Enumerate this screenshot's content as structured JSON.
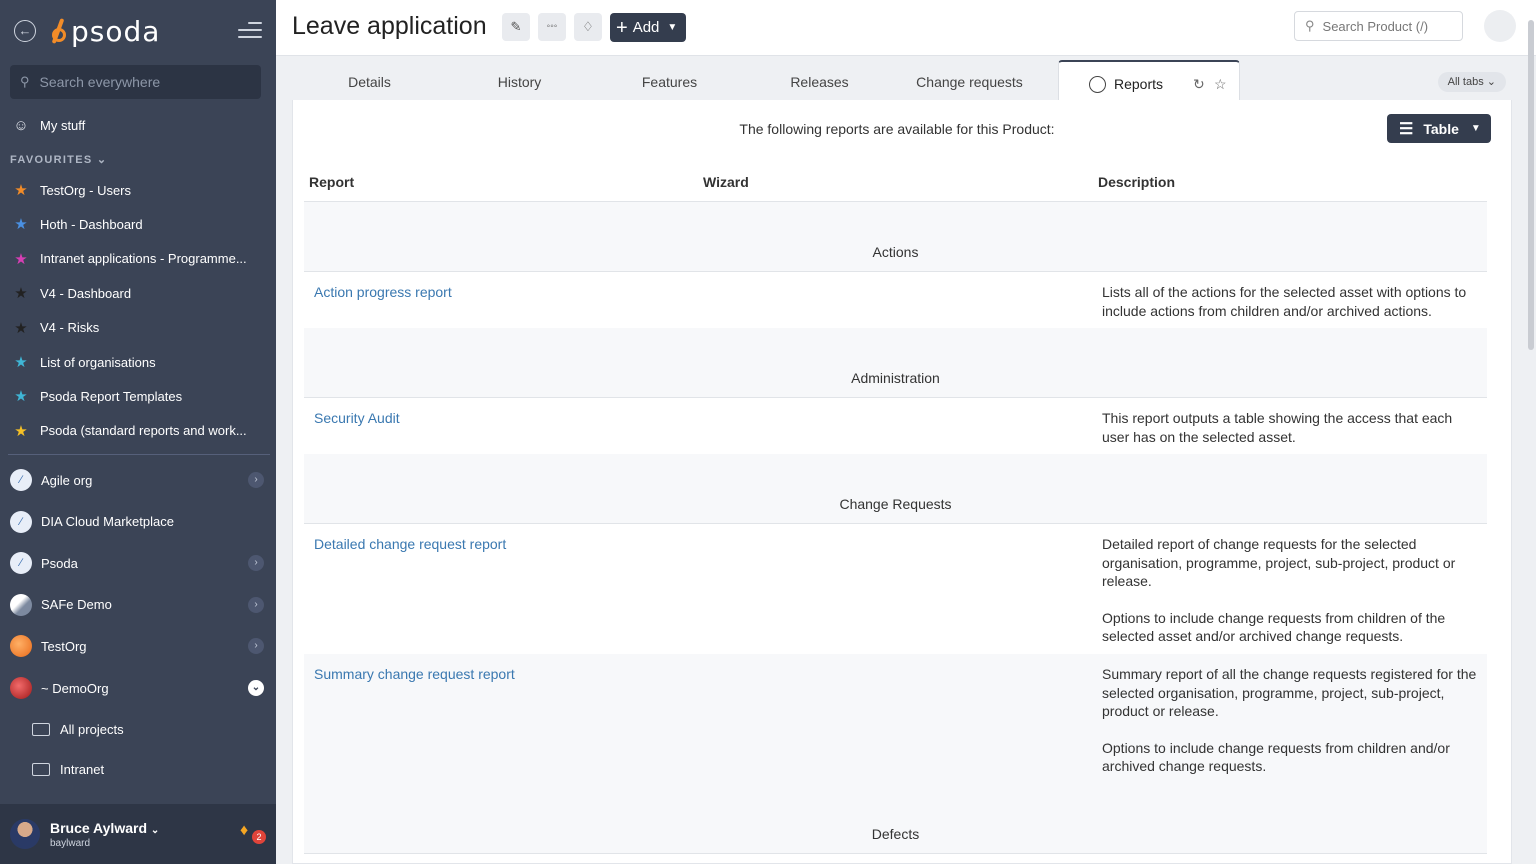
{
  "sidebar": {
    "logo_text": "psoda",
    "search_placeholder": "Search everywhere",
    "my_stuff": "My stuff",
    "favourites_title": "FAVOURITES",
    "favourites": [
      {
        "label": "TestOrg - Users",
        "color": "#f28c28"
      },
      {
        "label": "Hoth - Dashboard",
        "color": "#4a90e2"
      },
      {
        "label": "Intranet applications - Programme...",
        "color": "#d63fb4"
      },
      {
        "label": "V4 - Dashboard",
        "color": "#222222"
      },
      {
        "label": "V4 - Risks",
        "color": "#222222"
      },
      {
        "label": "List of organisations",
        "color": "#3fb6d6"
      },
      {
        "label": "Psoda Report Templates",
        "color": "#3fb6d6"
      },
      {
        "label": "Psoda (standard reports and work...",
        "color": "#f5c026"
      }
    ],
    "orgs": [
      {
        "label": "Agile org"
      },
      {
        "label": "DIA Cloud Marketplace"
      },
      {
        "label": "Psoda"
      },
      {
        "label": "SAFe Demo"
      },
      {
        "label": "TestOrg"
      },
      {
        "label": "~ DemoOrg"
      }
    ],
    "projects": [
      {
        "label": "All projects"
      },
      {
        "label": "Intranet"
      }
    ],
    "user": {
      "name": "Bruce Aylward",
      "login": "baylward",
      "notifications": "2"
    }
  },
  "header": {
    "title": "Leave application",
    "add_label": "Add",
    "search_placeholder": "Search Product (/)"
  },
  "tabs": {
    "items": [
      {
        "label": "Details"
      },
      {
        "label": "History"
      },
      {
        "label": "Features"
      },
      {
        "label": "Releases"
      },
      {
        "label": "Change requests"
      },
      {
        "label": "Reports"
      }
    ],
    "all_tabs": "All tabs"
  },
  "reports": {
    "intro": "The following reports are available for this Product:",
    "view_label": "Table",
    "columns": {
      "report": "Report",
      "wizard": "Wizard",
      "description": "Description"
    },
    "groups": [
      {
        "name": "Actions",
        "rows": [
          {
            "report": "Action progress report",
            "description": [
              "Lists all of the actions for the selected asset with options to include actions from children and/or archived actions."
            ]
          }
        ]
      },
      {
        "name": "Administration",
        "rows": [
          {
            "report": "Security Audit",
            "description": [
              "This report outputs a table showing the access that each user has on the selected asset."
            ]
          }
        ]
      },
      {
        "name": "Change Requests",
        "rows": [
          {
            "report": "Detailed change request report",
            "description": [
              "Detailed report of change requests for the selected organisation, programme, project, sub-project, product or release.",
              "Options to include change requests from children of the selected asset and/or archived change requests."
            ]
          },
          {
            "report": "Summary change request report",
            "description": [
              "Summary report of all the change requests registered for the selected organisation, programme, project, sub-project, product or release.",
              "Options to include change requests from children and/or archived change requests."
            ]
          }
        ]
      },
      {
        "name": "Defects",
        "rows": []
      }
    ]
  }
}
